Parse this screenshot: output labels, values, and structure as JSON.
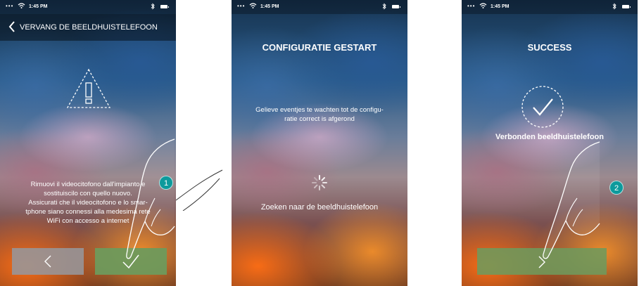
{
  "status_bar": {
    "time": "1:45 PM",
    "signal": "•••"
  },
  "screen1": {
    "header_title": "VERVANG DE BEELDHUISTELEFOON",
    "instructions": [
      "Rimuovi il videocitofono dall'impianto e",
      "sostituiscilo con quello nuovo.",
      "Assicurati che il videocitofono e lo smar-",
      "tphone siano connessi alla medesima rete",
      "WiFi con accesso a internet"
    ],
    "step_badge": "1",
    "back_button_icon": "chevron-left-icon",
    "confirm_button_icon": "check-icon"
  },
  "screen2": {
    "title": "CONFIGURATIE GESTART",
    "message": [
      "Gelieve eventjes te wachten tot de configu-",
      "ratie correct is afgerond"
    ],
    "search_text": "Zoeken naar de beeldhuistelefoon"
  },
  "screen3": {
    "title": "SUCCESS",
    "message": "Verbonden beeldhuistelefoon",
    "step_badge": "2",
    "next_button_icon": "chevron-right-icon"
  },
  "colors": {
    "confirm_green": "#6e9a5c",
    "back_gray": "#8e8f92",
    "badge_teal": "#0d9a9c"
  }
}
